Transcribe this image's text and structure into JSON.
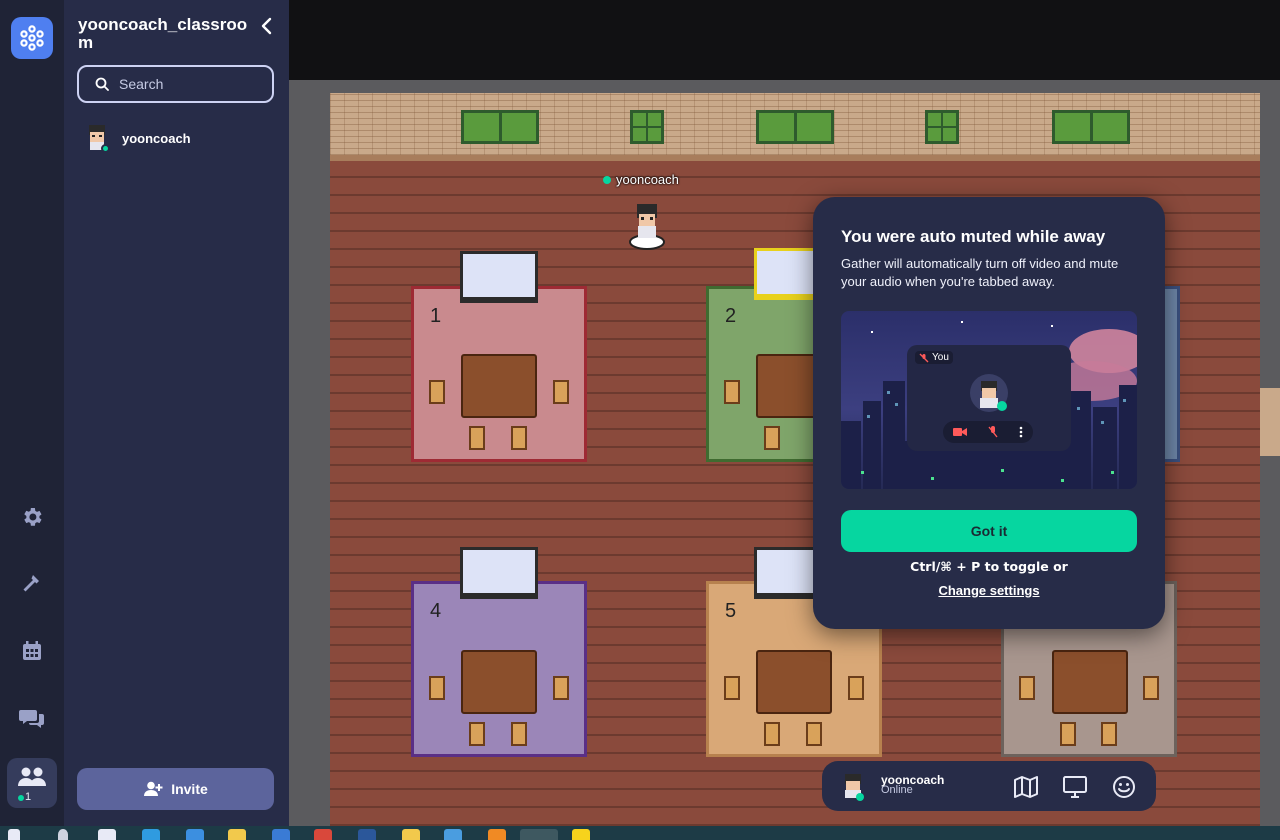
{
  "app": {
    "space_name": "yooncoach_classroom",
    "accent_color": "#06d6a0",
    "brand_color": "#4f7ff0"
  },
  "rail": {
    "items": [
      {
        "icon": "settings-icon"
      },
      {
        "icon": "build-hammer-icon"
      },
      {
        "icon": "calendar-icon"
      },
      {
        "icon": "chat-icon"
      },
      {
        "icon": "participants-icon"
      }
    ],
    "participant_count": "1"
  },
  "sidebar": {
    "search_placeholder": "Search",
    "members": [
      {
        "name": "yooncoach",
        "status_color": "#06d6a0"
      }
    ],
    "invite_label": "Invite"
  },
  "map": {
    "player_name": "yooncoach",
    "tables": [
      "1",
      "2",
      "4",
      "5"
    ]
  },
  "modal": {
    "title": "You were auto muted while away",
    "body": "Gather will automatically turn off video and mute your audio when you're tabbed away.",
    "illustration_label": "You",
    "confirm_label": "Got it",
    "hint": "Ctrl/⌘ + P to toggle or",
    "link": "Change settings"
  },
  "toolbar": {
    "name": "yooncoach",
    "status": "Online",
    "buttons": [
      "map-icon",
      "screen-share-icon",
      "emoji-icon"
    ]
  }
}
